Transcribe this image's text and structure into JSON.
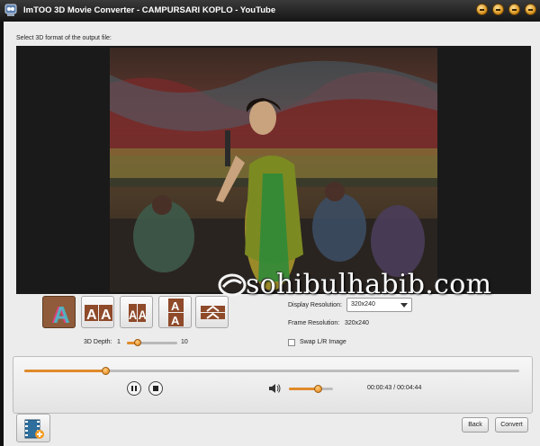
{
  "window": {
    "title": "ImTOO 3D Movie Converter - CAMPURSARI KOPLO - YouTube"
  },
  "main": {
    "prompt": "Select 3D format of the output file:",
    "watermark": "sohibulhabib.com",
    "formats": [
      {
        "name": "anaglyph",
        "selected": true
      },
      {
        "name": "side-by-side-full"
      },
      {
        "name": "side-by-side-half"
      },
      {
        "name": "top-and-bottom-full"
      },
      {
        "name": "top-and-bottom-half"
      }
    ],
    "depth": {
      "label": "3D Depth:",
      "min": "1",
      "max": "10",
      "value": 3,
      "range": [
        1,
        10
      ]
    },
    "display_resolution": {
      "label": "Display Resolution:",
      "value": "320x240"
    },
    "frame_resolution": {
      "label": "Frame Resolution:",
      "value": "320x240"
    },
    "swap": {
      "label": "Swap L/R Image",
      "checked": false
    }
  },
  "player": {
    "progress": 0.163,
    "volume": 0.65,
    "time": "00:00:43 / 00:04:44"
  },
  "footer": {
    "back_label": "Back",
    "convert_label": "Convert"
  },
  "colors": {
    "accent": "#e08a2a",
    "selected_format": "#8f5b3a",
    "titlebar": "#1c1c1c"
  }
}
